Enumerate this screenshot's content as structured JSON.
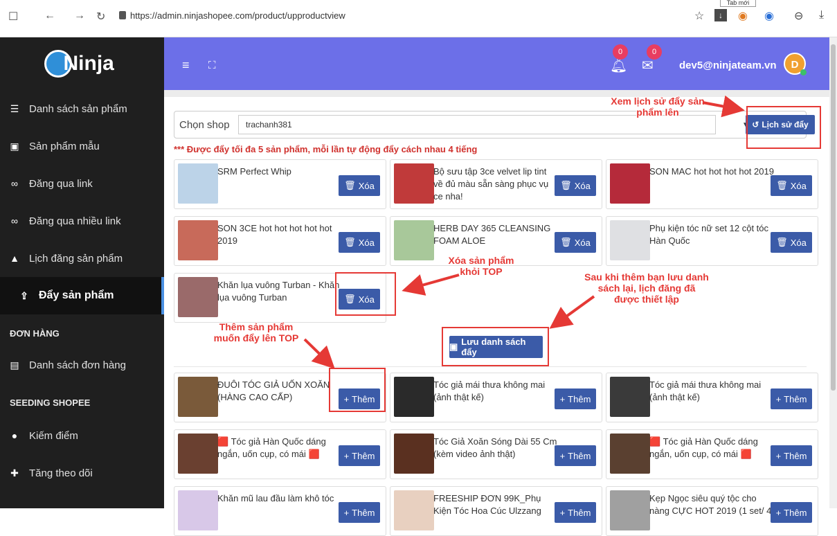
{
  "browser": {
    "url": "https://admin.ninjashopee.com/product/upproductview",
    "tab_tooltip": "Tab mới"
  },
  "sidebar": {
    "logo_text": "Ninja",
    "items": [
      {
        "label": "Danh sách sản phẩm",
        "icon": "list-icon"
      },
      {
        "label": "Sản phẩm mẫu",
        "icon": "file-icon"
      },
      {
        "label": "Đăng qua link",
        "icon": "link-icon"
      },
      {
        "label": "Đăng qua nhiều link",
        "icon": "link-icon"
      },
      {
        "label": "Lịch đăng sản phẩm",
        "icon": "bell-icon"
      },
      {
        "label": "Đẩy sản phẩm",
        "icon": "upload-icon",
        "active": true
      }
    ],
    "section_orders": "ĐƠN HÀNG",
    "order_items": [
      {
        "label": "Danh sách đơn hàng",
        "icon": "table-icon"
      }
    ],
    "section_seeding": "SEEDING SHOPEE",
    "seeding_items": [
      {
        "label": "Kiếm điểm",
        "icon": "coin-icon"
      },
      {
        "label": "Tăng theo dõi",
        "icon": "user-plus-icon"
      }
    ]
  },
  "topbar": {
    "notif_count": "0",
    "mail_count": "0",
    "user_email": "dev5@ninjateam.vn",
    "avatar_letter": "D"
  },
  "main": {
    "shop_label": "Chọn shop",
    "shop_value": "trachanh381",
    "history_button": "Lịch sử đẩy",
    "notice": "*** Được đẩy tối đa 5 sản phẩm, mỗi lần tự động đẩy cách nhau 4 tiếng",
    "delete_label": "Xóa",
    "add_label": "Thêm",
    "save_button": "Lưu danh sách đẩy",
    "top_products": [
      {
        "title": "SRM Perfect Whip"
      },
      {
        "title": "Bộ sưu tập 3ce velvet lip tint về đủ màu sẵn sàng phục vụ ce nha!"
      },
      {
        "title": "SON MAC hot hot hot hot 2019"
      },
      {
        "title": "SON 3CE hot hot hot hot hot 2019"
      },
      {
        "title": "HERB DAY 365 CLEANSING FOAM ALOE"
      },
      {
        "title": "Phụ kiện tóc nữ set 12 cột tóc Hàn Quốc"
      },
      {
        "title": "Khăn lụa vuông Turban - Khăn lụa vuông Turban"
      }
    ],
    "available_products": [
      {
        "title": "ĐUÔI TÓC GIẢ UỐN XOĂN (HÀNG CAO CẤP)"
      },
      {
        "title": "Tóc giả mái thưa không mai (ảnh thật kế)"
      },
      {
        "title": "Tóc giả mái thưa không mai (ảnh thật kế)"
      },
      {
        "title": "🟥 Tóc giả Hàn Quốc dáng ngắn, uốn cụp, có mái 🟥"
      },
      {
        "title": "Tóc Giả Xoăn Sóng Dài 55 Cm (kèm video ảnh thật)"
      },
      {
        "title": "🟥 Tóc giả Hàn Quốc dáng ngắn, uốn cụp, có mái 🟥"
      },
      {
        "title": "Khăn mũ lau đầu làm khô tóc"
      },
      {
        "title": "FREESHIP ĐƠN 99K_Phụ Kiện Tóc Hoa Cúc Ulzzang"
      },
      {
        "title": "Kẹp Ngọc siêu quý tộc cho nàng CỰC HOT 2019 (1 set/ 4"
      }
    ]
  },
  "annotations": {
    "history": "Xem lịch sử đẩy sản phẩm lên",
    "remove": "Xóa sản phẩm khỏi TOP",
    "save": "Sau khi thêm bạn lưu danh sách lại, lịch đăng đã được thiết lập",
    "add": "Thêm sản phẩm muốn đẩy lên TOP"
  },
  "colors": {
    "topbar": "#6c6fe8",
    "sidebar": "#1f1f1f",
    "button": "#3b5ba8",
    "highlight": "#e53935"
  }
}
